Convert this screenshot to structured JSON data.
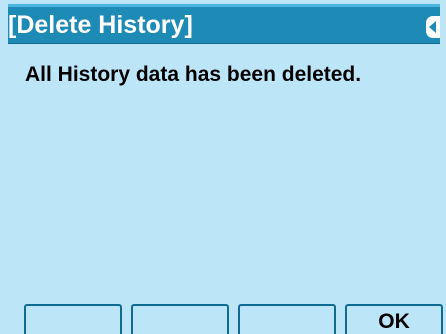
{
  "title": "[Delete History]",
  "message": "All History data has been deleted.",
  "softkeys": [
    {
      "label": ""
    },
    {
      "label": ""
    },
    {
      "label": ""
    },
    {
      "label": "OK"
    }
  ],
  "colors": {
    "screen_bg": "#bce6f8",
    "title_bg": "#1e8ab6",
    "title_text": "#ffffff",
    "key_border": "#0f6b92"
  }
}
